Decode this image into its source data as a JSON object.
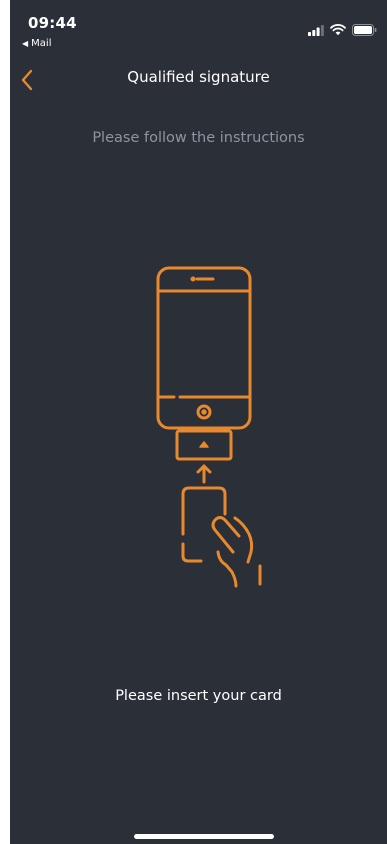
{
  "status_bar": {
    "time": "09:44",
    "back_app": "Mail",
    "back_arrow": "◀",
    "icons": [
      "signal-icon",
      "wifi-icon",
      "battery-icon"
    ]
  },
  "header": {
    "title": "Qualified signature",
    "back_icon": "chevron-left-icon"
  },
  "main": {
    "instructions": "Please follow the instructions",
    "illustration_icon": "phone-card-reader-icon",
    "prompt": "Please insert your card"
  },
  "colors": {
    "background": "#2b2f38",
    "accent": "#e8892e",
    "muted_text": "#8f949d",
    "text": "#ffffff"
  }
}
